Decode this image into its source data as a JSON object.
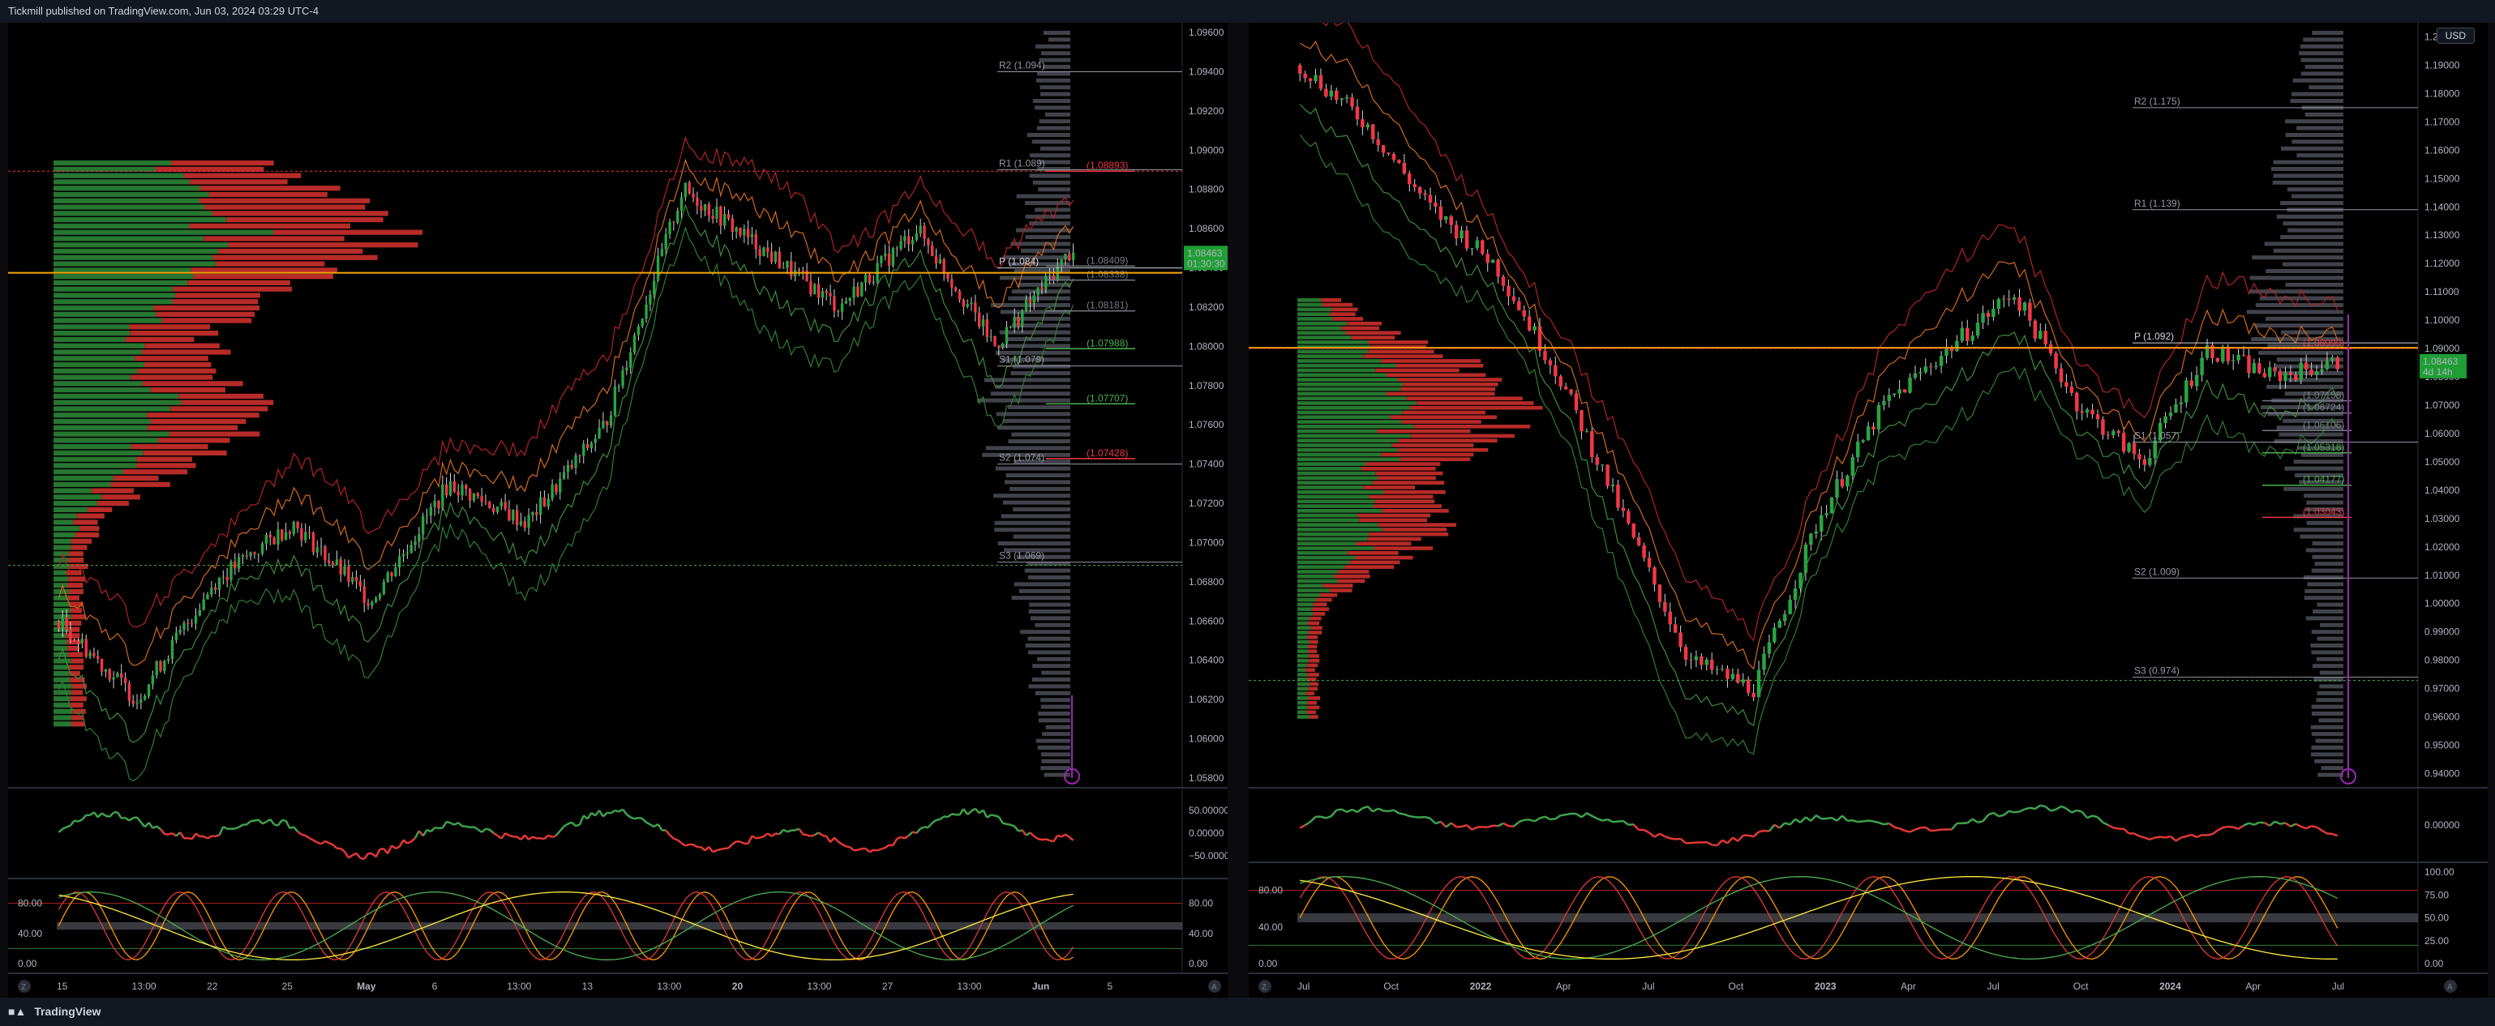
{
  "header": {
    "publisher_line": "Tickmill published on TradingView.com, Jun 03, 2024 03:29 UTC-4"
  },
  "footer": {
    "brand": "TradingView",
    "brand_icon": "tradingview-logo-icon"
  },
  "left_chart": {
    "price_axis": [
      "1.09600",
      "1.09400",
      "1.09200",
      "1.09000",
      "1.08800",
      "1.08600",
      "1.08400",
      "1.08200",
      "1.08000",
      "1.07800",
      "1.07600",
      "1.07400",
      "1.07200",
      "1.07000",
      "1.06800",
      "1.06600",
      "1.06400",
      "1.06200",
      "1.06000",
      "1.05800"
    ],
    "price_range": [
      1.0575,
      1.0965
    ],
    "current_price": "1.08463",
    "countdown": "01:30:30",
    "levels": [
      {
        "label": "R2 (1.094)",
        "price": 1.094,
        "color": "#9598a1"
      },
      {
        "label": "R1 (1.089)",
        "price": 1.089,
        "color": "#9598a1"
      },
      {
        "label": "P (1.084)",
        "price": 1.084,
        "color": "#d1d4dc"
      },
      {
        "label": "S1 (1.079)",
        "price": 1.079,
        "color": "#9598a1"
      },
      {
        "label": "S2 (1.074)",
        "price": 1.074,
        "color": "#9598a1"
      },
      {
        "label": "S3 (1.069)",
        "price": 1.069,
        "color": "#9598a1"
      }
    ],
    "tags": [
      {
        "label": "(1.08893)",
        "price": 1.08893,
        "color": "#f23645"
      },
      {
        "label": "(1.08409)",
        "price": 1.08409,
        "color": "#787b86"
      },
      {
        "label": "(1.08338)",
        "price": 1.08338,
        "color": "#787b86"
      },
      {
        "label": "(1.08181)",
        "price": 1.08181,
        "color": "#787b86"
      },
      {
        "label": "(1.07988)",
        "price": 1.07988,
        "color": "#4caf50"
      },
      {
        "label": "(1.07707)",
        "price": 1.07707,
        "color": "#4caf50"
      },
      {
        "label": "(1.07428)",
        "price": 1.07428,
        "color": "#f23645"
      }
    ],
    "time_axis": [
      "15",
      "13:00",
      "22",
      "25",
      "May",
      "6",
      "13:00",
      "13",
      "13:00",
      "20",
      "13:00",
      "27",
      "13:00",
      "Jun",
      "5"
    ],
    "rsi_axis": [
      "50.00000",
      "0.00000",
      "−50.00000"
    ],
    "stoch_axis_left": [
      "80.00",
      "40.00",
      "0.00"
    ],
    "stoch_axis_right": [
      "80.00",
      "40.00",
      "0.00"
    ],
    "bottom_buttons": [
      "Z",
      "A"
    ]
  },
  "right_chart": {
    "currency": "USD",
    "price_axis": [
      "1.20000",
      "1.19000",
      "1.18000",
      "1.17000",
      "1.16000",
      "1.15000",
      "1.14000",
      "1.13000",
      "1.12000",
      "1.11000",
      "1.10000",
      "1.09000",
      "1.08000",
      "1.07000",
      "1.06000",
      "1.05000",
      "1.04000",
      "1.03000",
      "1.02000",
      "1.01000",
      "1.00000",
      "0.99000",
      "0.98000",
      "0.97000",
      "0.96000",
      "0.95000",
      "0.94000"
    ],
    "price_range": [
      0.935,
      1.205
    ],
    "current_price": "1.08463",
    "countdown": "4d 14h",
    "levels": [
      {
        "label": "R2 (1.175)",
        "price": 1.175,
        "color": "#9598a1"
      },
      {
        "label": "R1 (1.139)",
        "price": 1.139,
        "color": "#9598a1"
      },
      {
        "label": "P (1.092)",
        "price": 1.092,
        "color": "#d1d4dc"
      },
      {
        "label": "S1 (1.057)",
        "price": 1.057,
        "color": "#9598a1"
      },
      {
        "label": "S2 (1.009)",
        "price": 1.009,
        "color": "#9598a1"
      },
      {
        "label": "S3 (0.974)",
        "price": 0.974,
        "color": "#9598a1"
      }
    ],
    "tags": [
      {
        "label": "(1.08999)",
        "price": 1.08999,
        "color": "#f23645"
      },
      {
        "label": "(1.07158)",
        "price": 1.07158,
        "color": "#787b86"
      },
      {
        "label": "(1.06724)",
        "price": 1.06724,
        "color": "#787b86"
      },
      {
        "label": "(1.06106)",
        "price": 1.06106,
        "color": "#787b86"
      },
      {
        "label": "(1.05318)",
        "price": 1.05318,
        "color": "#4caf50"
      },
      {
        "label": "(1.04177)",
        "price": 1.04177,
        "color": "#4caf50"
      },
      {
        "label": "(1.03043)",
        "price": 1.03043,
        "color": "#f23645"
      }
    ],
    "time_axis": [
      "Jul",
      "Oct",
      "2022",
      "Apr",
      "Jul",
      "Oct",
      "2023",
      "Apr",
      "Jul",
      "Oct",
      "2024",
      "Apr",
      "Jul"
    ],
    "rsi_axis": [
      "0.00000"
    ],
    "stoch_axis_left": [
      "80.00",
      "40.00",
      "0.00"
    ],
    "stoch_axis_right": [
      "100.00",
      "75.00",
      "50.00",
      "25.00",
      "0.00"
    ],
    "bottom_buttons": [
      "Z",
      "A"
    ]
  },
  "colors": {
    "up": "#26a641",
    "down": "#f23645",
    "pivot": "#f7a600",
    "bg": "#000000",
    "panel": "#131722",
    "price_tag": "#1f9e35",
    "alert": "#9c27b0"
  }
}
